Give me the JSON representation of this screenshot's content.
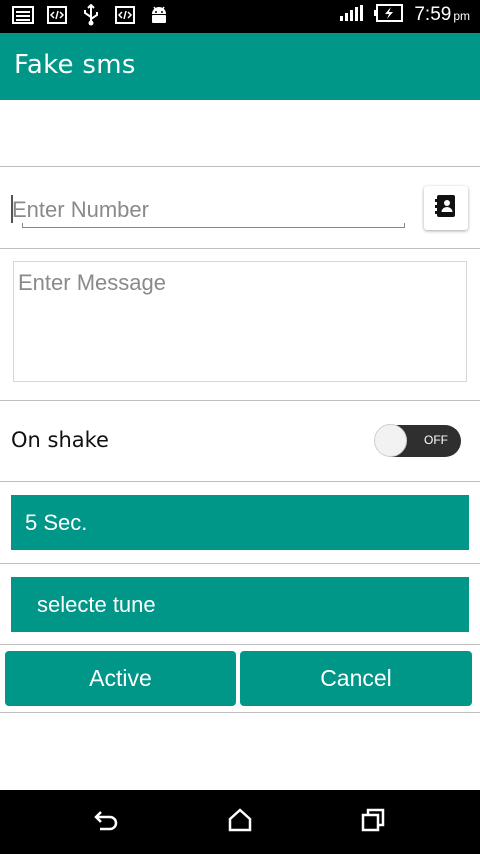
{
  "status_bar": {
    "time": "7:59",
    "ampm": "pm",
    "icons": [
      "gallery-icon",
      "code-icon",
      "usb-icon",
      "code-icon",
      "android-debug-icon"
    ],
    "right_icons": [
      "signal-icon",
      "battery-charging-icon"
    ]
  },
  "app_bar": {
    "title": "Fake sms"
  },
  "number_field": {
    "placeholder": "Enter Number",
    "value": ""
  },
  "contacts_button": {
    "icon": "contacts-book-icon"
  },
  "message_field": {
    "placeholder": "Enter Message",
    "value": ""
  },
  "shake": {
    "label": "On shake",
    "toggle_state": "OFF"
  },
  "delay": {
    "label": "5 Sec."
  },
  "tune": {
    "label": "selecte tune"
  },
  "actions": {
    "active_label": "Active",
    "cancel_label": "Cancel"
  },
  "nav": {
    "icons": [
      "back-icon",
      "home-icon",
      "recents-icon"
    ]
  },
  "colors": {
    "accent": "#009688",
    "status_bar": "#000000",
    "nav_bar": "#000000"
  }
}
